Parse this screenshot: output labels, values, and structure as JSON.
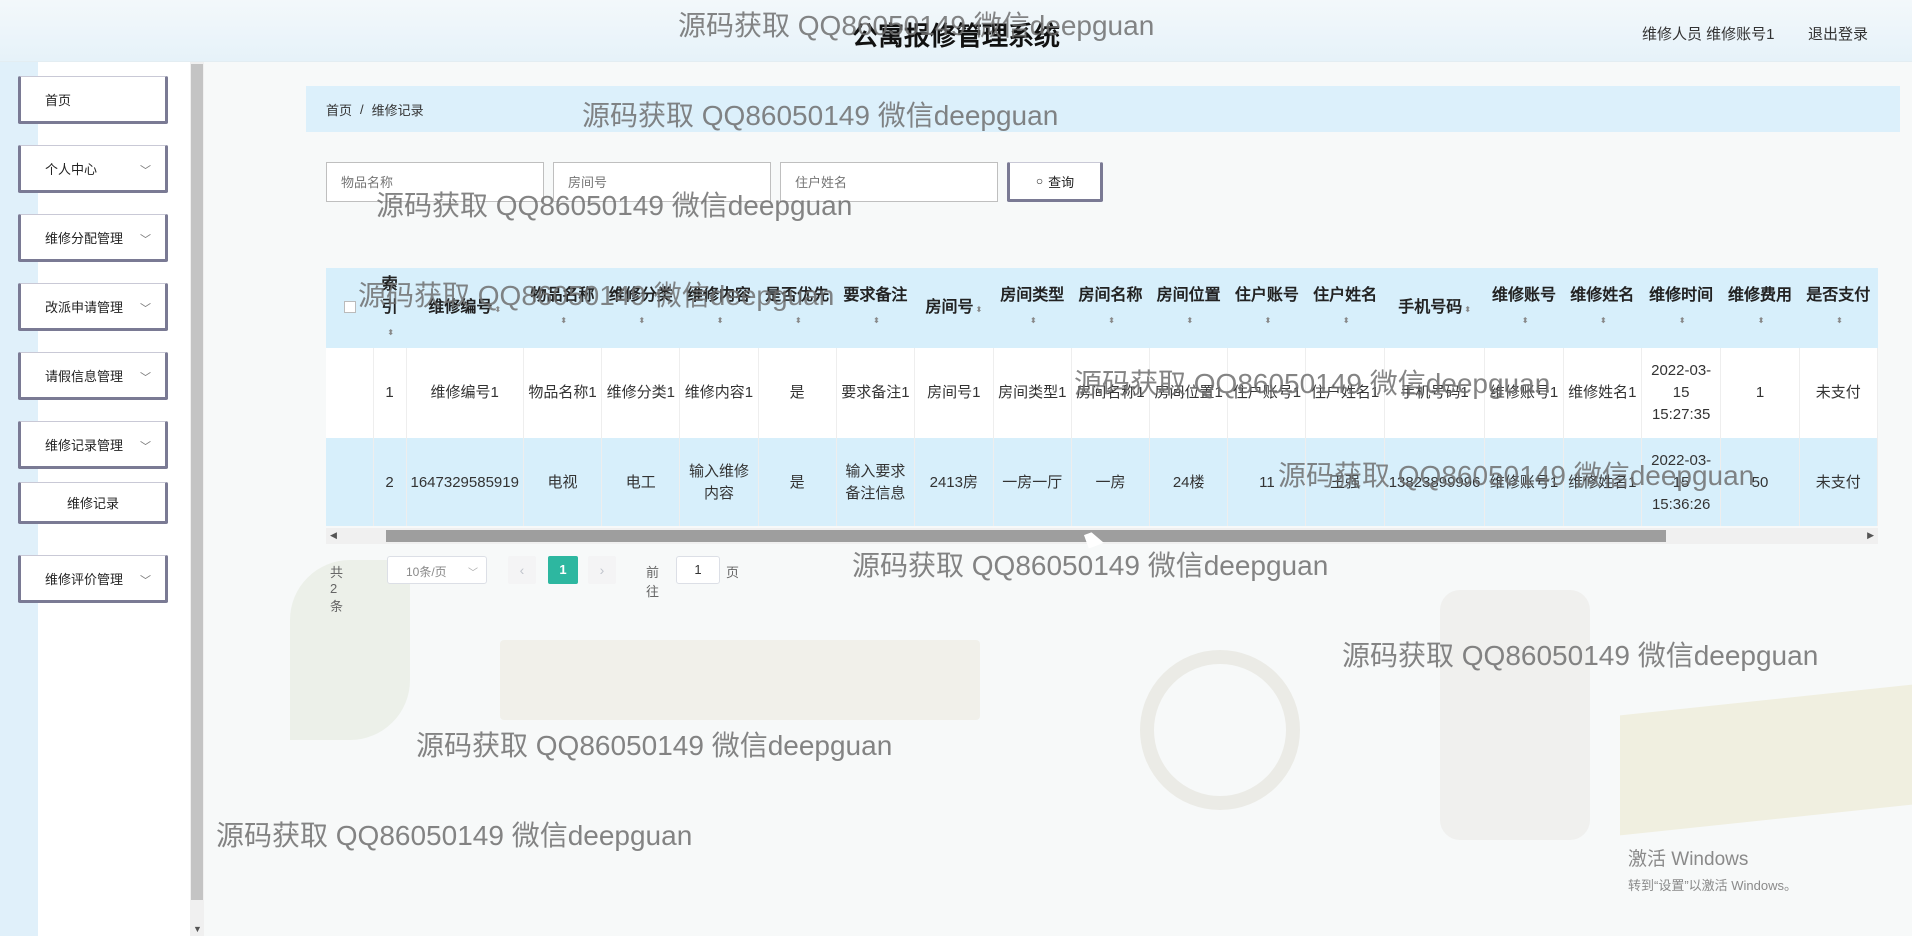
{
  "header": {
    "title": "公寓报修管理系统",
    "user": "维修人员 维修账号1",
    "logout": "退出登录"
  },
  "sidebar": {
    "items": [
      {
        "label": "首页",
        "has_children": false
      },
      {
        "label": "个人中心",
        "has_children": true
      },
      {
        "label": "维修分配管理",
        "has_children": true
      },
      {
        "label": "改派申请管理",
        "has_children": true
      },
      {
        "label": "请假信息管理",
        "has_children": true
      },
      {
        "label": "维修记录管理",
        "has_children": true
      },
      {
        "label": "维修记录",
        "has_children": false,
        "sub": true
      },
      {
        "label": "维修评价管理",
        "has_children": true
      }
    ]
  },
  "breadcrumb": {
    "home": "首页",
    "separator": "/",
    "current": "维修记录"
  },
  "search": {
    "item_placeholder": "物品名称",
    "room_placeholder": "房间号",
    "resident_placeholder": "住户姓名",
    "button_label": "查询"
  },
  "table": {
    "columns": [
      "索引",
      "维修编号",
      "物品名称",
      "维修分类",
      "维修内容",
      "是否优先",
      "要求备注",
      "房间号",
      "房间类型",
      "房间名称",
      "房间位置",
      "住户账号",
      "住户姓名",
      "手机号码",
      "维修账号",
      "维修姓名",
      "维修时间",
      "维修费用",
      "是否支付"
    ],
    "rows": [
      [
        "1",
        "维修编号1",
        "物品名称1",
        "维修分类1",
        "维修内容1",
        "是",
        "要求备注1",
        "房间号1",
        "房间类型1",
        "房间名称1",
        "房间位置1",
        "住户账号1",
        "住户姓名1",
        "手机号码1",
        "维修账号1",
        "维修姓名1",
        "2022-03-15 15:27:35",
        "1",
        "未支付"
      ],
      [
        "2",
        "1647329585919",
        "电视",
        "电工",
        "输入维修内容",
        "是",
        "输入要求备注信息",
        "2413房",
        "一房一厅",
        "一房",
        "24楼",
        "11",
        "王强",
        "13823899996",
        "维修账号1",
        "维修姓名1",
        "2022-03-15 15:36:26",
        "50",
        "未支付"
      ]
    ]
  },
  "pagination": {
    "total": "共 2 条",
    "page_size": "10条/页",
    "current_page": "1",
    "goto_prefix": "前往",
    "goto_value": "1",
    "goto_suffix": "页"
  },
  "windows_activation": {
    "line1": "激活 Windows",
    "line2": "转到“设置”以激活 Windows。"
  },
  "watermark": {
    "text": "源码获取 QQ86050149 微信deepguan"
  },
  "colors": {
    "accent": "#2db7a0",
    "header_bg": "#e6f2f9",
    "table_header_bg": "#d7effb",
    "menu_border": "#7a7a94"
  }
}
